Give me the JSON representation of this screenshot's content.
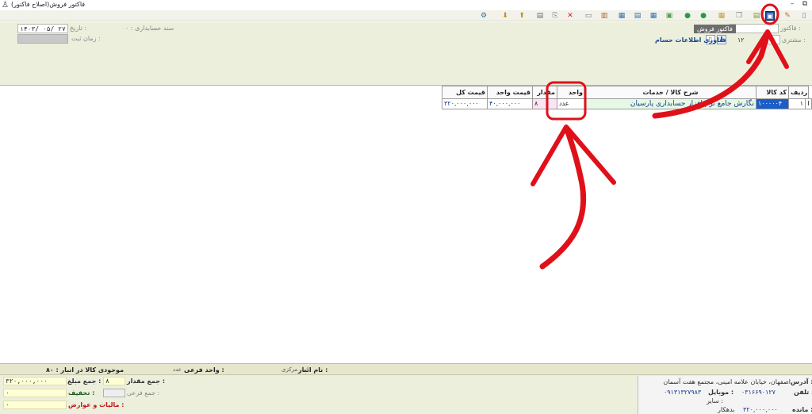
{
  "window": {
    "title": "فاکتور فروش(اصلاح فاکتور)"
  },
  "toolbar": {
    "icons": [
      "new-icon",
      "edit-icon",
      "save-icon",
      "print-icon",
      "copy-icon",
      "paste-icon",
      "next-icon",
      "prev-icon",
      "first-icon",
      "last-icon",
      "list-icon",
      "grid-icon",
      "report-icon",
      "calc-icon",
      "delete-icon",
      "attach-icon",
      "export-icon",
      "import-icon",
      "search-icon",
      "folder-icon",
      "open-icon",
      "settings-icon"
    ]
  },
  "header": {
    "invoice_label": "فاکتور :",
    "invoice_tooltip": "فاکتور فروش",
    "customer_label": "مشتری :",
    "customer_code": "۱",
    "customer_code2": "۱۲",
    "customer_link": "فناوری اطلاعات حسام",
    "accounting_doc_label": "سند حسابداری : ۰",
    "date_label": "تاریخ :",
    "date_value": "۱۴۰۳/ ۰۵/ ۲۷",
    "register_time_label": "زمان ثبت :"
  },
  "grid": {
    "headers": {
      "row": "ردیف",
      "code": "کد کالا",
      "description": "شرح کالا / خدمات",
      "unit": "واحد",
      "quantity": "مقدار",
      "unit_price": "قیمت واحد",
      "total_price": "قیمت کل"
    },
    "rows": [
      {
        "indicator": "I",
        "row": "۱",
        "code": "۱۰۰۰۰۰۴",
        "description": "نگارش جامع نرم افزار حسابداری پارسیان",
        "unit": "عدد",
        "quantity": "۸",
        "unit_price": "۴۰,۰۰۰,۰۰۰",
        "total_price": "۳۲۰,۰۰۰,۰۰۰"
      }
    ]
  },
  "footer": {
    "warehouse_name_label": "نام انبار :",
    "warehouse_name": "انبار مرکزی",
    "sub_unit_label": "واحد فرعی :",
    "sub_unit_value": "عدد",
    "stock_label": "موجودی کالا در انبار : ۸۰",
    "total_qty_label": "جمع مقدار :",
    "total_qty": "۸",
    "total_amount_label": "جمع مبلغ :",
    "total_amount": "۳۲۰,۰۰۰,۰۰۰",
    "sub_total_label": "جمع فرعی :",
    "discount_label": "تخفیف :",
    "discount": "۰",
    "tax_label": "مالیات و عوارض :",
    "tax": "۰",
    "address_label": "آدرس :",
    "address": "اصفهان، خیابان علامه امینی، مجتمع هفت آسمان",
    "phone_label": "تلفن :",
    "phone": "۰۳۱۶۶۹۰۱۲۷",
    "mobile_label": "موبایل :",
    "mobile": "۰۹۱۳۱۳۲۷۹۸۳",
    "balance_label": "مانده :",
    "balance": "۳۲۰,۰۰۰,۰۰۰",
    "balance_status": "بدهکار",
    "other_label": "سایر :"
  },
  "colors": {
    "header_bg": "#ecefdc",
    "annotation_red": "#e0101a",
    "selected_cell": "#1c5ec8",
    "description_cell": "#e6f9e6",
    "quantity_cell": "#fbe4f4",
    "footer_yellow": "#ffffd6"
  }
}
